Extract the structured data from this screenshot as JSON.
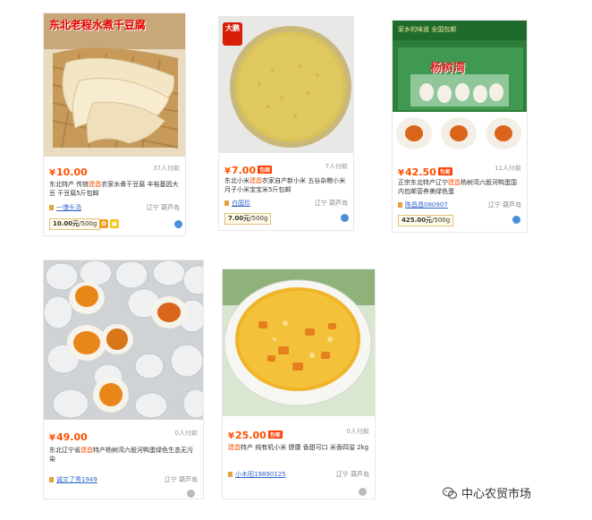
{
  "products": [
    {
      "image_text": "东北老程水煮千豆腐",
      "price": "10.00",
      "badge": "",
      "sales": "37人付款",
      "title_pre": "东北特产 传统",
      "title_hl": "建昌",
      "title_post": "农家水煮干豆腐 丰裕基因大豆 干豆腐5斤包邮",
      "shop": "一馒头汤",
      "location": "辽宁 葫芦岛",
      "spec_price": "10.00元",
      "spec_unit": "/500g"
    },
    {
      "image_text": "大鹏",
      "price": "7.00",
      "badge": "包邮",
      "sales": "7人付款",
      "title_pre": "东北小米",
      "title_hl": "建昌",
      "title_post": "农家自产新小米 五谷杂粮小米月子小米宝宝米5斤包邮",
      "shop": "白国珍",
      "location": "辽宁 葫芦岛",
      "spec_price": "7.00元",
      "spec_unit": "/500g"
    },
    {
      "image_text_top": "家乡的味道  全国包邮",
      "image_text": "杨树湾",
      "price": "42.50",
      "badge": "包邮",
      "sales": "11人付款",
      "title_pre": "正宗东北特产辽宁",
      "title_hl": "建昌",
      "title_post": "杨树湾六股河鸭蛋国内包邮营养美绿色蛋",
      "shop": "陈昌昌080907",
      "location": "辽宁 葫芦岛",
      "spec_price": "425.00元",
      "spec_unit": "/500g"
    },
    {
      "price": "49.00",
      "badge": "",
      "sales": "0人付款",
      "title_pre": "东北辽宁省",
      "title_hl": "建昌",
      "title_post": "特产杨树湾六股河鸭蛋绿色生态无污染",
      "shop": "诚文了秀1949",
      "location": "辽宁 葫芦岛"
    },
    {
      "price": "25.00",
      "badge": "包邮",
      "sales": "0人付款",
      "title_pre": "",
      "title_hl": "建昌",
      "title_post": "特产 纯有机小米 健康 香甜可口 米香四溢 2kg",
      "shop": "小木阳19890125",
      "location": "辽宁 葫芦岛"
    }
  ],
  "currency": "¥",
  "watermark": "中心农贸市场",
  "colors": {
    "price": "#ff5000",
    "shop_link": "#3366cc",
    "badge": "#ff3c00"
  }
}
